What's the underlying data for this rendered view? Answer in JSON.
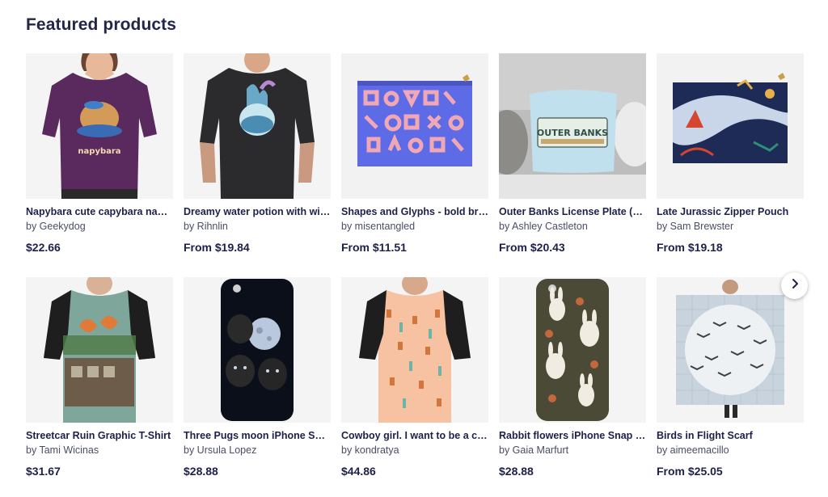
{
  "section": {
    "title": "Featured products"
  },
  "nav": {
    "next_icon": "chevron-right-icon"
  },
  "products": [
    {
      "title": "Napybara cute capybara nap ...",
      "artist": "by Geekydog",
      "price": "$22.66"
    },
    {
      "title": "Dreamy water potion with wiz...",
      "artist": "by Rihnlin",
      "price": "From $19.84"
    },
    {
      "title": "Shapes and Glyphs - bold bru...",
      "artist": "by misentangled",
      "price": "From $11.51"
    },
    {
      "title": "Outer Banks License Plate (Ou...",
      "artist": "by Ashley Castleton",
      "price": "From $20.43"
    },
    {
      "title": "Late Jurassic Zipper Pouch",
      "artist": "by Sam Brewster",
      "price": "From $19.18"
    },
    {
      "title": "Streetcar Ruin Graphic T-Shirt",
      "artist": "by Tami Wicinas",
      "price": "$31.67"
    },
    {
      "title": "Three Pugs moon iPhone Sna...",
      "artist": "by Ursula Lopez",
      "price": "$28.88"
    },
    {
      "title": "Cowboy girl. I want to be a co...",
      "artist": "by kondratya",
      "price": "$44.86"
    },
    {
      "title": "Rabbit flowers iPhone Snap C...",
      "artist": "by Gaia Marfurt",
      "price": "$28.88"
    },
    {
      "title": "Birds in Flight Scarf",
      "artist": "by aimeemacillo",
      "price": "From $25.05"
    }
  ],
  "image_text": {
    "napybara_print": "napybara",
    "license_plate": "OUTER BANKS"
  },
  "colors": {
    "heading": "#23264a",
    "thumb_bg": "#f3f3f4"
  }
}
